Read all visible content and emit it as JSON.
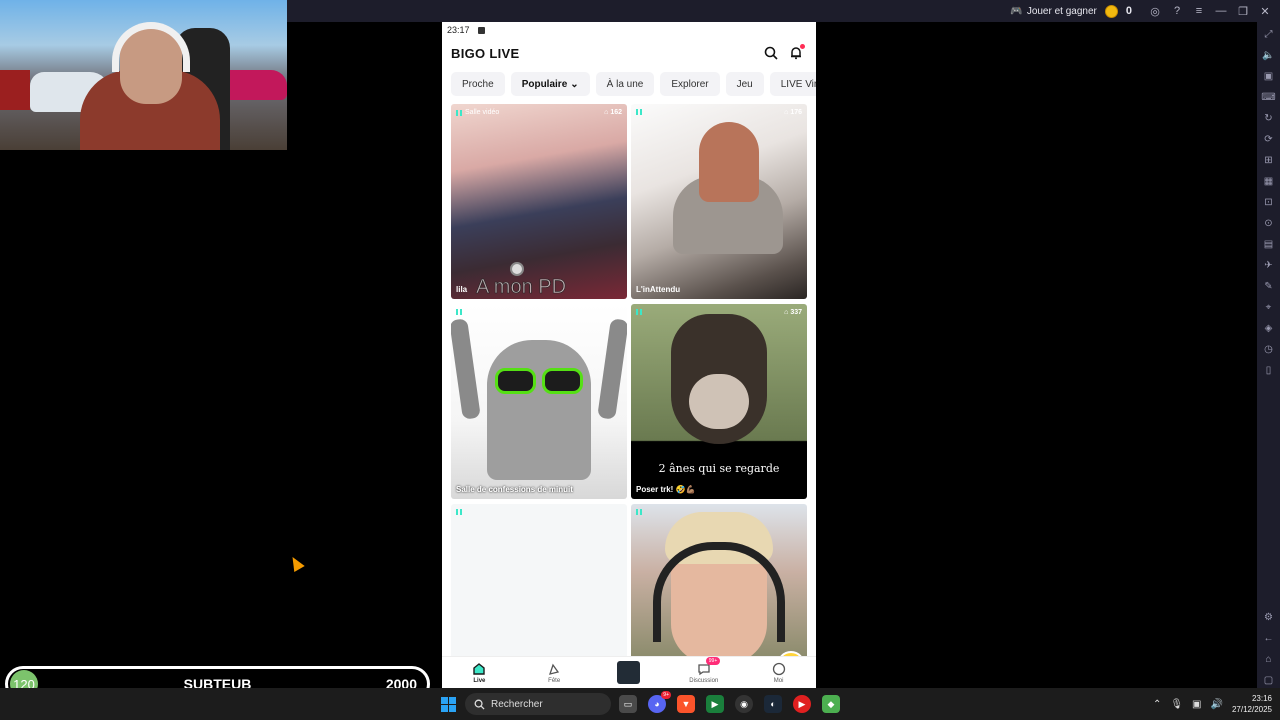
{
  "emulator": {
    "play_label": "Jouer et gagner",
    "coins": "0"
  },
  "phone": {
    "status_time": "23:17",
    "app_title": "BIGO LIVE",
    "tabs": [
      {
        "label": "Proche"
      },
      {
        "label": "Populaire",
        "active": true
      },
      {
        "label": "À la une"
      },
      {
        "label": "Explorer"
      },
      {
        "label": "Jeu"
      },
      {
        "label": "LIVE Virtuel"
      }
    ],
    "cards": [
      {
        "tag": "Salle vidéo",
        "viewers": "162",
        "name": "lila",
        "overlay_text": "A mon PD"
      },
      {
        "tag": "",
        "viewers": "176",
        "name": "L'inAttendu"
      },
      {
        "tag": "",
        "viewers": "",
        "name": "Salle de confessions de minuit"
      },
      {
        "tag": "",
        "viewers": "337",
        "name": "Poser trk! 🤣💪🏽",
        "caption": "2 ânes qui se regarde"
      },
      {
        "tag": "",
        "viewers": "",
        "name": ""
      },
      {
        "tag": "",
        "viewers": "",
        "name": ""
      }
    ],
    "bottom_nav": [
      {
        "label": "Live",
        "active": true
      },
      {
        "label": "Fête"
      },
      {
        "label": ""
      },
      {
        "label": "Discussion",
        "badge": "99+"
      },
      {
        "label": "Moi"
      }
    ]
  },
  "overlay": {
    "sub_count": "120",
    "sub_label": "SUBTEUB",
    "sub_goal": "2000"
  },
  "taskbar": {
    "search_placeholder": "Rechercher",
    "discord_badge": "9+",
    "time": "23:16",
    "date": "27/12/2025"
  }
}
